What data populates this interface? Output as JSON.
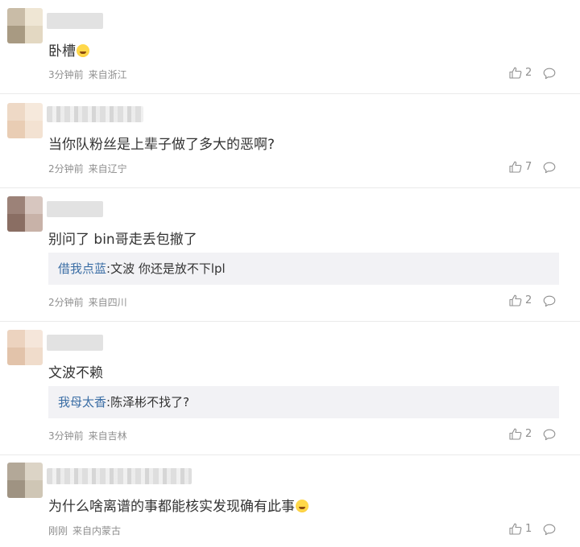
{
  "comments": [
    {
      "text": "卧槽",
      "time": "3分钟前",
      "location": "来自浙江",
      "likes": "2",
      "avatar_colors": [
        "#c9bca7",
        "#efe6d4",
        "#a89a82",
        "#e3d8c2"
      ]
    },
    {
      "text": "当你队粉丝是上辈子做了多大的恶啊?",
      "time": "2分钟前",
      "location": "来自辽宁",
      "likes": "7",
      "avatar_colors": [
        "#eed9c6",
        "#f6e9dc",
        "#e9cdb4",
        "#f3e2d2"
      ]
    },
    {
      "text": "别问了 bin哥走丢包撤了",
      "reply_name": "借我点蓝",
      "reply_text": ":文波 你还是放不下lpl",
      "time": "2分钟前",
      "location": "来自四川",
      "likes": "2",
      "avatar_colors": [
        "#9c8278",
        "#d7c6bf",
        "#8a6e63",
        "#c8b2a8"
      ]
    },
    {
      "text": "文波不赖",
      "reply_name": "我母太香",
      "reply_text": ":陈泽彬不找了?",
      "time": "3分钟前",
      "location": "来自吉林",
      "likes": "2",
      "avatar_colors": [
        "#ecd3bf",
        "#f5e6da",
        "#e2c3aa",
        "#f0dccb"
      ]
    },
    {
      "text": "为什么啥离谱的事都能核实发现确有此事",
      "time": "刚刚",
      "location": "来自内蒙古",
      "likes": "1",
      "avatar_colors": [
        "#b3a898",
        "#dcd4c6",
        "#9f9382",
        "#cfc6b5"
      ]
    }
  ]
}
